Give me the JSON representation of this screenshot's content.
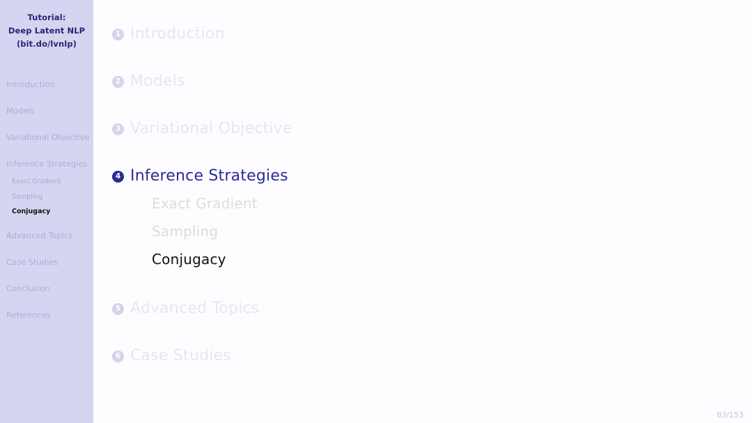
{
  "sidebar": {
    "title_lines": [
      "Tutorial:",
      "Deep Latent NLP",
      "(bit.do/lvnlp)"
    ],
    "items": [
      {
        "label": "Introduction",
        "state": "inactive"
      },
      {
        "label": "Models",
        "state": "inactive"
      },
      {
        "label": "Variational Objective",
        "state": "inactive"
      },
      {
        "label": "Inference Strategies",
        "state": "inactive"
      },
      {
        "label": "Advanced Topics",
        "state": "inactive"
      },
      {
        "label": "Case Studies",
        "state": "inactive"
      },
      {
        "label": "Conclusion",
        "state": "inactive"
      },
      {
        "label": "References",
        "state": "inactive"
      }
    ],
    "subitems": [
      {
        "label": "Exact Gradient",
        "state": "inactive"
      },
      {
        "label": "Sampling",
        "state": "inactive"
      },
      {
        "label": "Conjugacy",
        "state": "current"
      }
    ]
  },
  "main": {
    "entries": [
      {
        "number": "1",
        "label": "Introduction",
        "state": "inactive"
      },
      {
        "number": "2",
        "label": "Models",
        "state": "inactive"
      },
      {
        "number": "3",
        "label": "Variational Objective",
        "state": "inactive"
      },
      {
        "number": "4",
        "label": "Inference Strategies",
        "state": "active"
      },
      {
        "number": "5",
        "label": "Advanced Topics",
        "state": "inactive"
      },
      {
        "number": "6",
        "label": "Case Studies",
        "state": "inactive"
      }
    ],
    "subentries": [
      {
        "label": "Exact Gradient",
        "state": "inactive"
      },
      {
        "label": "Sampling",
        "state": "inactive"
      },
      {
        "label": "Conjugacy",
        "state": "current"
      }
    ]
  },
  "footer": {
    "page": "83/153"
  },
  "colors": {
    "sidebar_bg": "#d5d5f2",
    "main_bg": "#fdfdff",
    "accent": "#2b2b96",
    "faded": "#e6e6ef",
    "sidebar_text": "#adadd6"
  }
}
